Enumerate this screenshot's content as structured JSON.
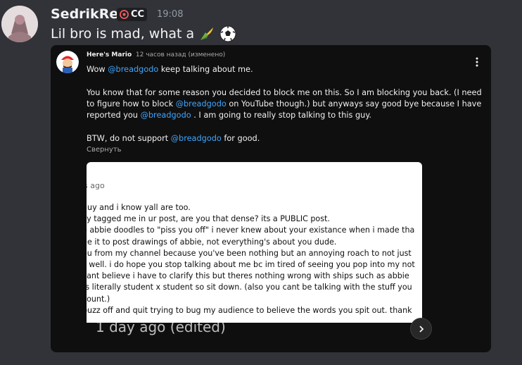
{
  "author": {
    "name": "SedrikRed",
    "tag": "CC",
    "time": "19:08"
  },
  "message": {
    "text": "Lil bro is mad, what a",
    "emojis": [
      "corn-emoji",
      "soccer-ball-emoji"
    ]
  },
  "embed": {
    "author": "Here's Mario",
    "meta": "12 часов назад (изменено)",
    "comment": {
      "p1_a": "Wow ",
      "p1_mention": "@breadgodo",
      "p1_b": " keep talking about me.",
      "p2_a": "You know that for some reason you decided to block me on this. So I am blocking you back. (I need to figure how to block ",
      "p2_mention1": "@breadgodo",
      "p2_b": " on YouTube though.) but anyways say good bye because I have reported you ",
      "p2_mention2": "@breadgodo",
      "p2_c": " . I am going to really stop talking to this guy.",
      "p3_a": "BTW, do not support ",
      "p3_mention": "@breadgodo",
      "p3_b": " for good."
    },
    "collapse_label": "Свернуть",
    "screenshot": {
      "time": "s ago",
      "lines": [
        "guy and i know yall are too.",
        "lly tagged me in ur post, are you that dense? its a PUBLIC post.",
        "e abbie doodles to \"piss you off\" i never knew about your existance when i made tha",
        "de it to post drawings of abbie, not everything's about you dude.",
        "ou from my channel because you've been nothing but an annoying roach to not just",
        "s well. i do hope you stop talking about me bc im tired of seeing you pop into my not",
        "cant believe i have to clarify this but theres nothing wrong with ships such as abbie",
        "ts literally student x student so sit down. (also you cant be talking with the stuff you",
        "count.)",
        "buzz off and quit trying to bug my audience to believe the words you spit out. thank"
      ],
      "below_text": "1 day ago (edited)"
    },
    "next_icon": "chevron-right-icon"
  }
}
